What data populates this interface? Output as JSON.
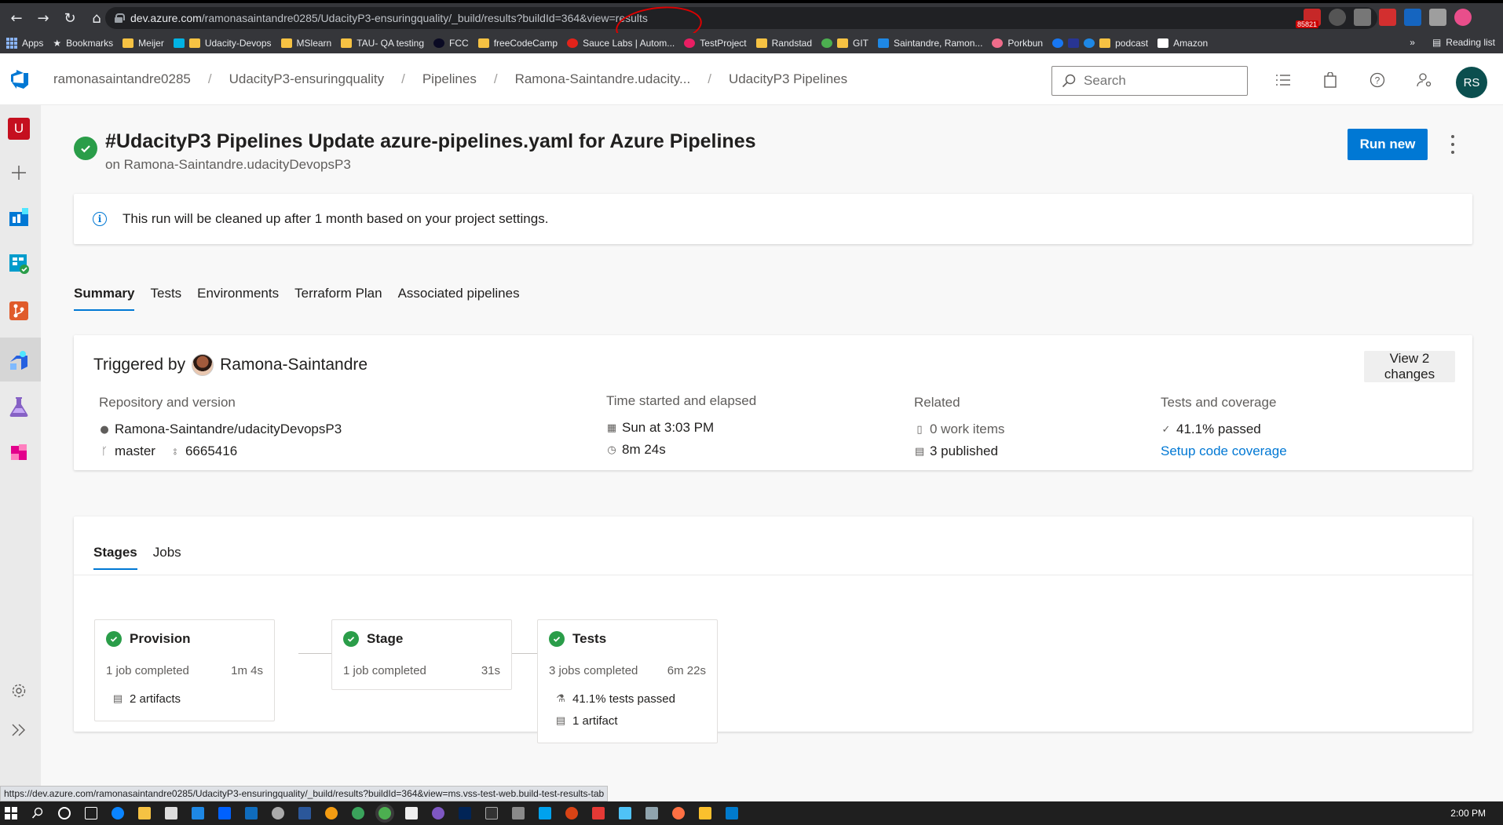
{
  "browser": {
    "url_host": "dev.azure.com",
    "url_path": "/ramonasaintandre0285/UdacityP3-ensuringquality/_build/results?buildId=364&view=results",
    "ext_badge": "85821",
    "bookmarks": [
      "Apps",
      "Bookmarks",
      "Meijer",
      "Udacity-Devops",
      "MSlearn",
      "TAU- QA testing",
      "FCC",
      "freeCodeCamp",
      "Sauce Labs | Autom...",
      "TestProject",
      "Randstad",
      "GIT",
      "Saintandre, Ramon...",
      "Porkbun",
      "podcast",
      "Amazon"
    ],
    "reading_list": "Reading list",
    "overflow": "»"
  },
  "header": {
    "breadcrumbs": [
      "ramonasaintandre0285",
      "UdacityP3-ensuringquality",
      "Pipelines",
      "Ramona-Saintandre.udacity...",
      "UdacityP3 Pipelines"
    ],
    "search_placeholder": "Search",
    "avatar_initials": "RS"
  },
  "rail": {
    "org_initial": "U"
  },
  "run": {
    "title": "#UdacityP3 Pipelines Update azure-pipelines.yaml for Azure Pipelines",
    "subtitle": "on Ramona-Saintandre.udacityDevopsP3",
    "run_new_label": "Run new",
    "info_text": "This run will be cleaned up after 1 month based on your project settings."
  },
  "tabs": [
    "Summary",
    "Tests",
    "Environments",
    "Terraform Plan",
    "Associated pipelines"
  ],
  "summary": {
    "triggered_by_label": "Triggered by",
    "triggered_by_user": "Ramona-Saintandre",
    "view_changes_label": "View 2 changes",
    "repo": {
      "label": "Repository and version",
      "name": "Ramona-Saintandre/udacityDevopsP3",
      "branch": "master",
      "commit": "6665416"
    },
    "time": {
      "label": "Time started and elapsed",
      "started": "Sun at 3:03 PM",
      "elapsed": "8m 24s"
    },
    "related": {
      "label": "Related",
      "work_items": "0 work items",
      "published": "3 published"
    },
    "tests": {
      "label": "Tests and coverage",
      "passed": "41.1% passed",
      "setup_link": "Setup code coverage"
    }
  },
  "stages_tabs": [
    "Stages",
    "Jobs"
  ],
  "stages": [
    {
      "name": "Provision",
      "jobs": "1 job completed",
      "duration": "1m 4s",
      "extras": [
        "2 artifacts"
      ]
    },
    {
      "name": "Stage",
      "jobs": "1 job completed",
      "duration": "31s",
      "extras": []
    },
    {
      "name": "Tests",
      "jobs": "3 jobs completed",
      "duration": "6m 22s",
      "extras": [
        "41.1% tests passed",
        "1 artifact"
      ]
    }
  ],
  "status_url": "https://dev.azure.com/ramonasaintandre0285/UdacityP3-ensuringquality/_build/results?buildId=364&view=ms.vss-test-web.build-test-results-tab",
  "clock": "2:00 PM",
  "colors": {
    "accent": "#0078d4",
    "success": "#2a9d49",
    "org_tile": "#c50f1f",
    "avatar_bg": "#0b4f4f"
  }
}
